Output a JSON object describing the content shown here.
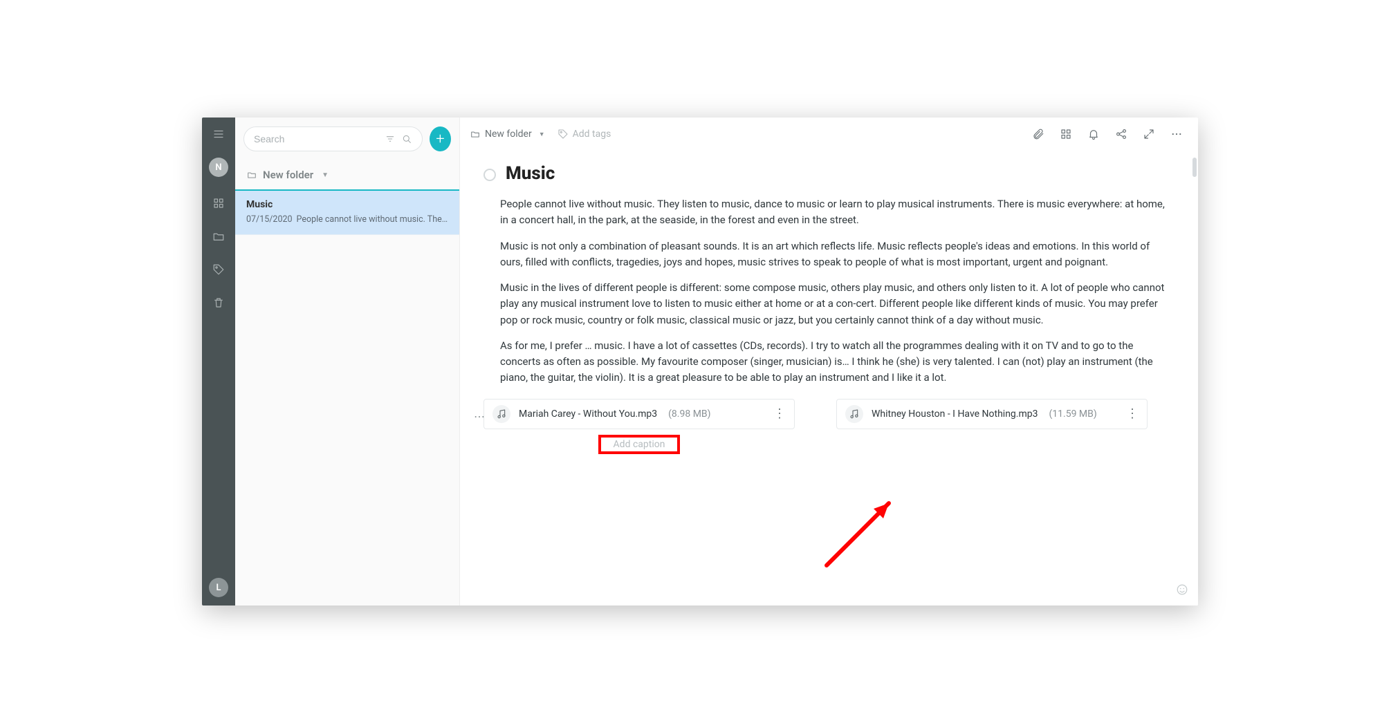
{
  "rail": {
    "avatar_top_initial": "N",
    "avatar_bottom_initial": "L"
  },
  "sidebar": {
    "search_placeholder": "Search",
    "folder_label": "New folder",
    "notes": [
      {
        "title": "Music",
        "date": "07/15/2020",
        "preview": "People cannot live without music. They l…"
      }
    ]
  },
  "header": {
    "breadcrumb": "New folder",
    "add_tags_label": "Add tags"
  },
  "document": {
    "title": "Music",
    "paragraphs": [
      "People cannot live without music. They listen to music, dance to music or learn to play musical instruments. There is music everywhere: at home, in a concert hall, in the park, at the seaside, in the forest and even in the street.",
      "Music is not only a combination of pleasant sounds. It is an art which reflects life. Music reflects people's ideas and emotions. In this world of ours, filled with conflicts, tragedies, joys and hopes, music strives to speak to people of what is most important, urgent and poignant.",
      "Music in the lives of different people is different: some compose music, others play music, and others only listen to it. A lot of people who cannot play any musical instrument love to listen to music either at home or at a con-cert. Different people like different kinds of music. You may prefer pop or rock music, country or folk music, classical music or jazz, but you certainly cannot think of a day without music.",
      "As for me, I prefer … music. I have a lot of cassettes (CDs, records). I try to watch all the programmes dealing with it on TV and to go to the concerts as often as possible. My favourite composer (singer, musician) is… I think he (she) is very talented. I can (not) play an instrument (the piano, the guitar, the violin). It is a great pleasure to be able to play an instrument and I like it a lot."
    ],
    "attachments": [
      {
        "name": "Mariah Carey - Without You.mp3",
        "size": "(8.98 MB)"
      },
      {
        "name": "Whitney Houston - I Have Nothing.mp3",
        "size": "(11.59 MB)"
      }
    ],
    "caption_placeholder": "Add caption"
  }
}
